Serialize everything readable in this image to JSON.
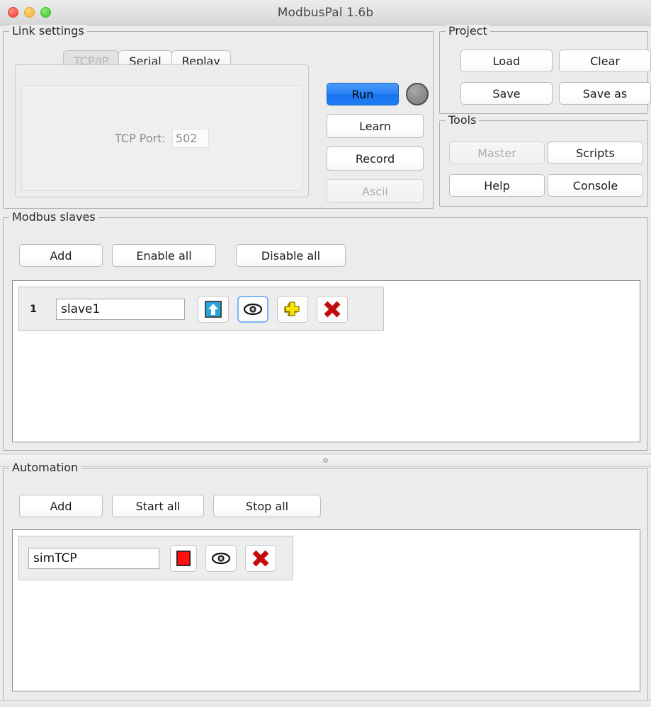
{
  "window": {
    "title": "ModbusPal 1.6b",
    "traffic_lights": [
      "close",
      "minimize",
      "maximize"
    ]
  },
  "link_settings": {
    "title": "Link settings",
    "tabs": [
      {
        "label": "TCP/IP",
        "selected": true,
        "disabled": true
      },
      {
        "label": "Serial",
        "selected": false,
        "disabled": false
      },
      {
        "label": "Replay",
        "selected": false,
        "disabled": false
      }
    ],
    "tcp": {
      "port_label": "TCP Port:",
      "port_value": "502"
    },
    "controls": {
      "run_label": "Run",
      "learn_label": "Learn",
      "record_label": "Record",
      "ascii_label": "Ascii",
      "ascii_disabled": true,
      "led_state": "off"
    }
  },
  "project": {
    "title": "Project",
    "buttons": [
      {
        "label": "Load",
        "disabled": false
      },
      {
        "label": "Clear",
        "disabled": false
      },
      {
        "label": "Save",
        "disabled": false
      },
      {
        "label": "Save as",
        "disabled": false
      }
    ]
  },
  "tools": {
    "title": "Tools",
    "buttons": [
      {
        "label": "Master",
        "disabled": true
      },
      {
        "label": "Scripts",
        "disabled": false
      },
      {
        "label": "Help",
        "disabled": false
      },
      {
        "label": "Console",
        "disabled": false
      }
    ]
  },
  "modbus_slaves": {
    "title": "Modbus slaves",
    "toolbar": [
      {
        "label": "Add"
      },
      {
        "label": "Enable all"
      },
      {
        "label": "Disable all"
      }
    ],
    "rows": [
      {
        "index": "1",
        "name": "slave1",
        "actions": [
          "export-up-arrow",
          "eye",
          "yellow-puzzle-plus",
          "red-x-delete"
        ]
      }
    ]
  },
  "automation": {
    "title": "Automation",
    "toolbar": [
      {
        "label": "Add"
      },
      {
        "label": "Start all"
      },
      {
        "label": "Stop all"
      }
    ],
    "rows": [
      {
        "name": "simTCP",
        "actions": [
          "red-stop-square",
          "eye",
          "red-x-delete"
        ]
      }
    ]
  },
  "colors": {
    "accent_blue": "#1f7bf2",
    "stop_red": "#e60000",
    "delete_red": "#cc1111",
    "arrow_blue": "#2fa8e0",
    "plus_yellow": "#f2d600",
    "panel_gray": "#ececec"
  }
}
